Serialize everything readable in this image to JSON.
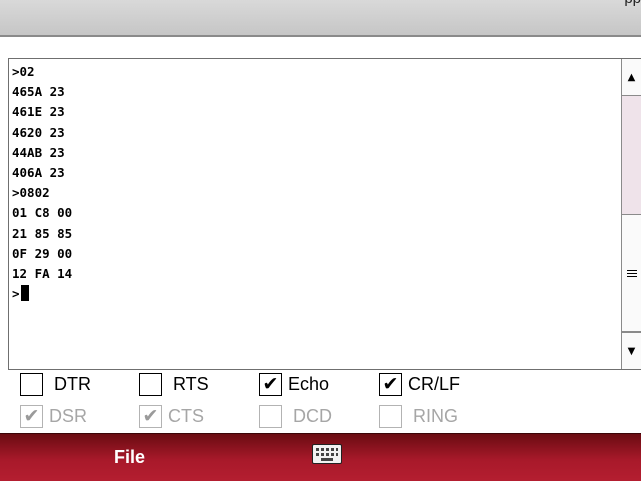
{
  "title_bar": {
    "title": "pp"
  },
  "terminal": {
    "lines": [
      ">02",
      "465A 23",
      "461E 23",
      "4620 23",
      "44AB 23",
      "406A 23",
      ">0802",
      "01 C8 00",
      "21 85 85",
      "0F 29 00",
      "12 FA 14"
    ],
    "prompt": ">"
  },
  "scrollbar": {
    "up_icon": "▲",
    "down_icon": "▼"
  },
  "controls": {
    "dtr": {
      "label": "DTR",
      "checked": false,
      "enabled": true
    },
    "rts": {
      "label": "RTS",
      "checked": false,
      "enabled": true
    },
    "echo": {
      "label": "Echo",
      "checked": true,
      "enabled": true
    },
    "crlf": {
      "label": "CR/LF",
      "checked": true,
      "enabled": true
    }
  },
  "status": {
    "dsr": {
      "label": "DSR",
      "checked": true,
      "enabled": false
    },
    "cts": {
      "label": "CTS",
      "checked": true,
      "enabled": false
    },
    "dcd": {
      "label": "DCD",
      "checked": false,
      "enabled": false
    },
    "ring": {
      "label": "RING",
      "checked": false,
      "enabled": false
    }
  },
  "menu": {
    "file_label": "File",
    "keyboard_icon": "keyboard-icon"
  },
  "colors": {
    "menubar": "#a8192a",
    "title_bar": "#c6c6c6",
    "scroll_track": "#efe3ea"
  }
}
